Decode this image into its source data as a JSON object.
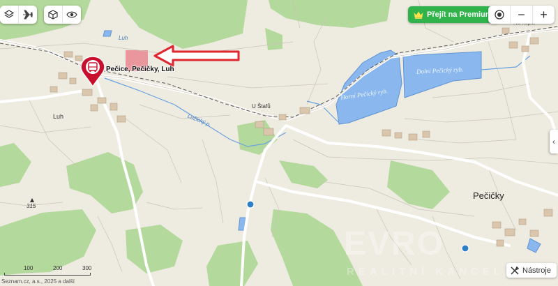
{
  "toolbar_left": {
    "layers_icon": "layers-icon",
    "flight_icon": "airplane-icon",
    "box_icon": "3d-cube-icon",
    "eye_icon": "eye-icon"
  },
  "premium": {
    "label": "Přejít na Premium",
    "icon": "crown-icon",
    "color": "#2fb34a"
  },
  "zoom": {
    "locate_icon": "location-target-icon",
    "minus": "−",
    "plus": "+"
  },
  "tools": {
    "label": "Nástroje",
    "icon": "tools-icon"
  },
  "marker": {
    "label": "Pečice, Pečičky, Luh",
    "icon": "bus-icon",
    "color": "#c8102e"
  },
  "places": {
    "luh": "Luh",
    "u_stafu": "U Štafů",
    "pecicky": "Pečičky",
    "na_kopci": "Na kopci",
    "elevation": "315",
    "stream": "Lužický p.",
    "upper_pond": "Horní Pečický ryb.",
    "lower_pond": "Dolní Pečický ryb."
  },
  "scale": {
    "labels": [
      "100",
      "200",
      "300"
    ]
  },
  "copyright": "Seznam.cz, a.s., 2025 a další",
  "watermark": {
    "main": "EVRO",
    "sub": "REALITNÍ KANCELÁŘ"
  },
  "colors": {
    "forest": "#b4d99c",
    "water": "#8ab8ee",
    "background": "#eeebe1",
    "road": "#ffffff",
    "arrow": "#e0262e"
  }
}
